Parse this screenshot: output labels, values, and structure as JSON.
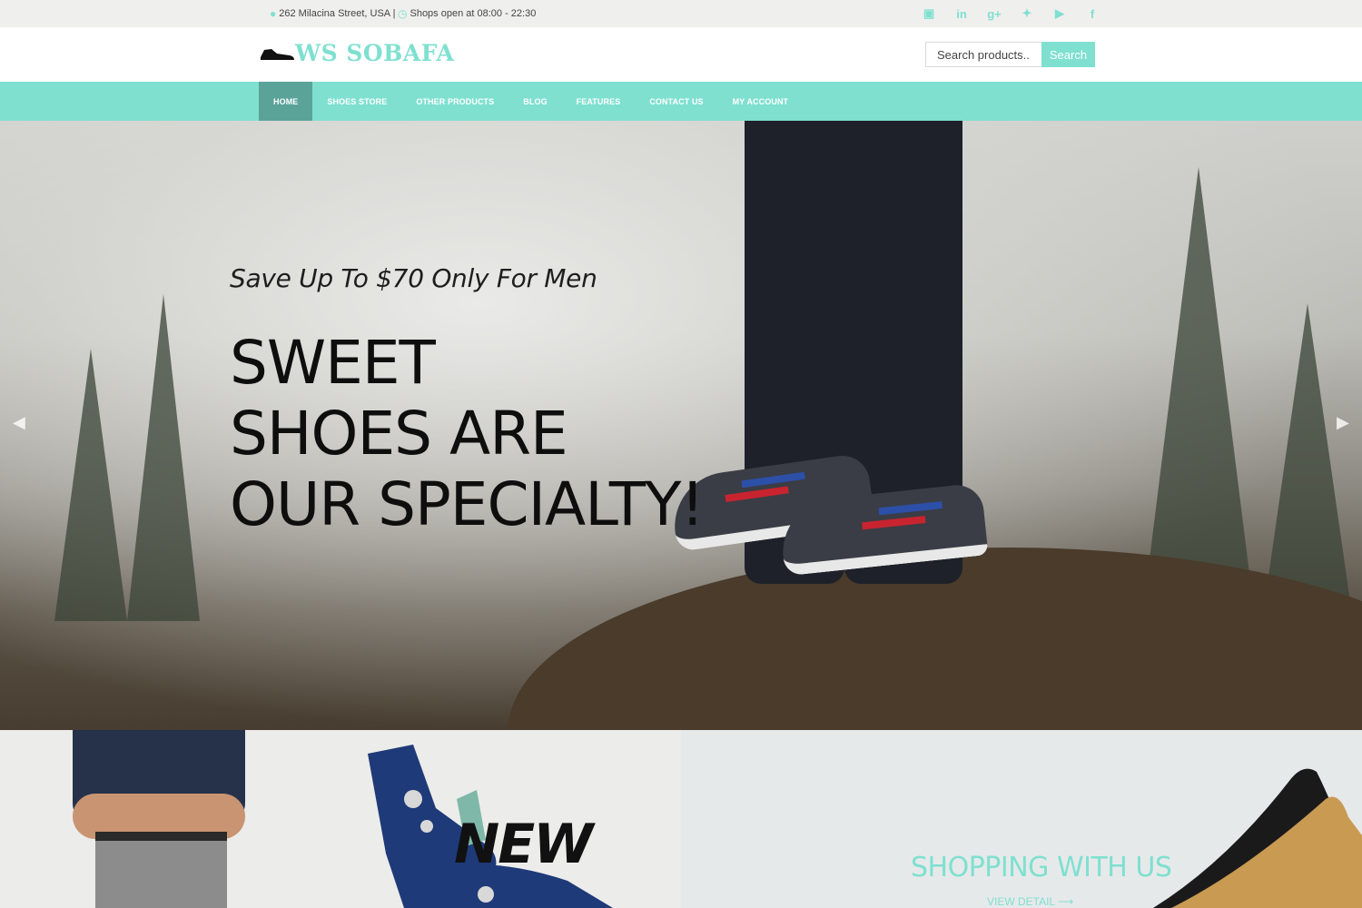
{
  "topbar": {
    "address": "262 Milacina Street, USA |",
    "hours": "Shops open at 08:00 - 22:30",
    "social_icons": [
      "instagram-icon",
      "linkedin-icon",
      "google-plus-icon",
      "twitter-icon",
      "youtube-icon",
      "facebook-icon"
    ]
  },
  "header": {
    "logo_text": "WS SOBAFA",
    "search_placeholder": "Search products...",
    "search_button": "Search"
  },
  "nav": {
    "items": [
      {
        "label": "HOME",
        "active": true
      },
      {
        "label": "SHOES STORE"
      },
      {
        "label": "OTHER PRODUCTS"
      },
      {
        "label": "BLOG"
      },
      {
        "label": "FEATURES"
      },
      {
        "label": "CONTACT US"
      },
      {
        "label": "MY ACCOUNT"
      }
    ]
  },
  "hero": {
    "subtitle": "Save Up To $70 Only For Men",
    "headline_line1": "SWEET",
    "headline_line2": "SHOES ARE",
    "headline_line3": "OUR SPECIALTY!"
  },
  "banners": {
    "new_label": "NEW",
    "shopping_title": "SHOPPING WITH US",
    "view_detail": "VIEW DETAIL"
  },
  "colors": {
    "accent": "#7fe0d0",
    "nav_active": "#5aa399",
    "topbar_bg": "#efefee"
  }
}
